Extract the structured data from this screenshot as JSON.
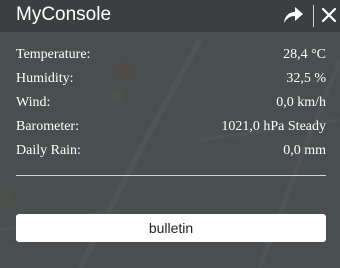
{
  "app": {
    "title": "MyConsole"
  },
  "icons": {
    "share": "share-arrow-icon",
    "close": "close-x-icon"
  },
  "readings": [
    {
      "label": "Temperature:",
      "value": "28,4 °C"
    },
    {
      "label": "Humidity:",
      "value": "32,5 %"
    },
    {
      "label": "Wind:",
      "value": "0,0 km/h"
    },
    {
      "label": "Barometer:",
      "value": "1021,0 hPa Steady"
    },
    {
      "label": "Daily Rain:",
      "value": "0,0 mm"
    }
  ],
  "actions": {
    "bulletin_label": "bulletin"
  },
  "colors": {
    "header_bg": "#3a3e3e",
    "panel_bg": "#3e4242",
    "text": "#ffffff",
    "button_bg": "#ffffff"
  }
}
